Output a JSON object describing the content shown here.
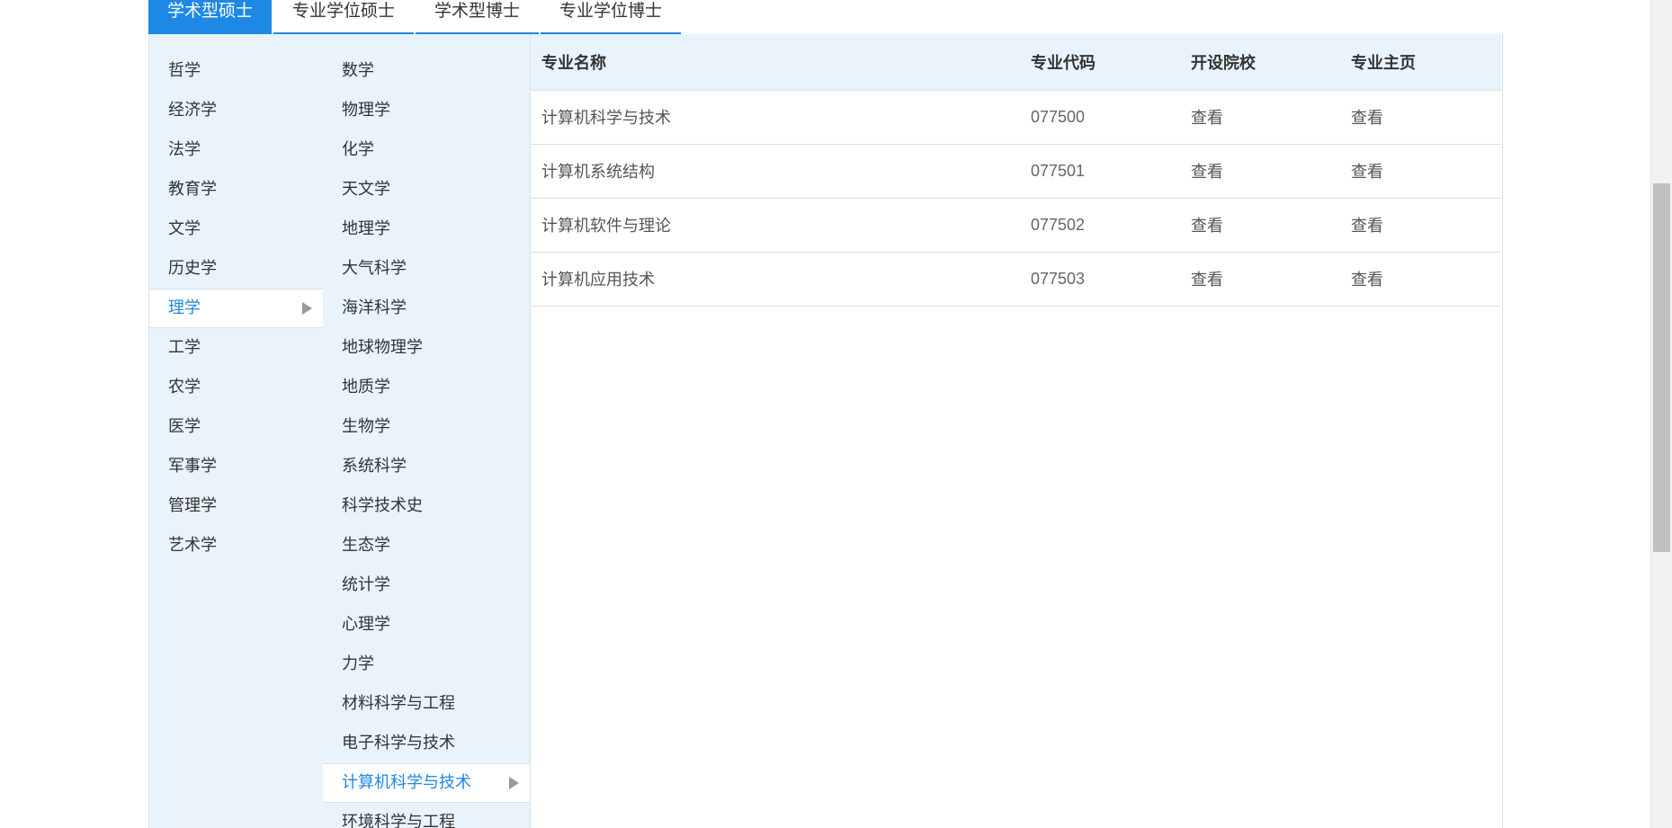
{
  "tabs": [
    {
      "label": "学术型硕士",
      "active": true
    },
    {
      "label": "专业学位硕士",
      "active": false
    },
    {
      "label": "学术型博士",
      "active": false
    },
    {
      "label": "专业学位博士",
      "active": false
    }
  ],
  "categories": [
    {
      "label": "哲学"
    },
    {
      "label": "经济学"
    },
    {
      "label": "法学"
    },
    {
      "label": "教育学"
    },
    {
      "label": "文学"
    },
    {
      "label": "历史学"
    },
    {
      "label": "理学",
      "active": true
    },
    {
      "label": "工学"
    },
    {
      "label": "农学"
    },
    {
      "label": "医学"
    },
    {
      "label": "军事学"
    },
    {
      "label": "管理学"
    },
    {
      "label": "艺术学"
    }
  ],
  "subcategories": [
    {
      "label": "数学"
    },
    {
      "label": "物理学"
    },
    {
      "label": "化学"
    },
    {
      "label": "天文学"
    },
    {
      "label": "地理学"
    },
    {
      "label": "大气科学"
    },
    {
      "label": "海洋科学"
    },
    {
      "label": "地球物理学"
    },
    {
      "label": "地质学"
    },
    {
      "label": "生物学"
    },
    {
      "label": "系统科学"
    },
    {
      "label": "科学技术史"
    },
    {
      "label": "生态学"
    },
    {
      "label": "统计学"
    },
    {
      "label": "心理学"
    },
    {
      "label": "力学"
    },
    {
      "label": "材料科学与工程"
    },
    {
      "label": "电子科学与技术"
    },
    {
      "label": "计算机科学与技术",
      "active": true
    },
    {
      "label": "环境科学与工程"
    }
  ],
  "table": {
    "headers": {
      "name": "专业名称",
      "code": "专业代码",
      "schools": "开设院校",
      "homepage": "专业主页"
    },
    "rows": [
      {
        "name": "计算机科学与技术",
        "code": "077500",
        "schools": "查看",
        "homepage": "查看"
      },
      {
        "name": "计算机系统结构",
        "code": "077501",
        "schools": "查看",
        "homepage": "查看"
      },
      {
        "name": "计算机软件与理论",
        "code": "077502",
        "schools": "查看",
        "homepage": "查看"
      },
      {
        "name": "计算机应用技术",
        "code": "077503",
        "schools": "查看",
        "homepage": "查看"
      }
    ]
  },
  "colors": {
    "accent": "#1e88e5",
    "panel_bg": "#e8f3fc",
    "text": "#333333"
  }
}
